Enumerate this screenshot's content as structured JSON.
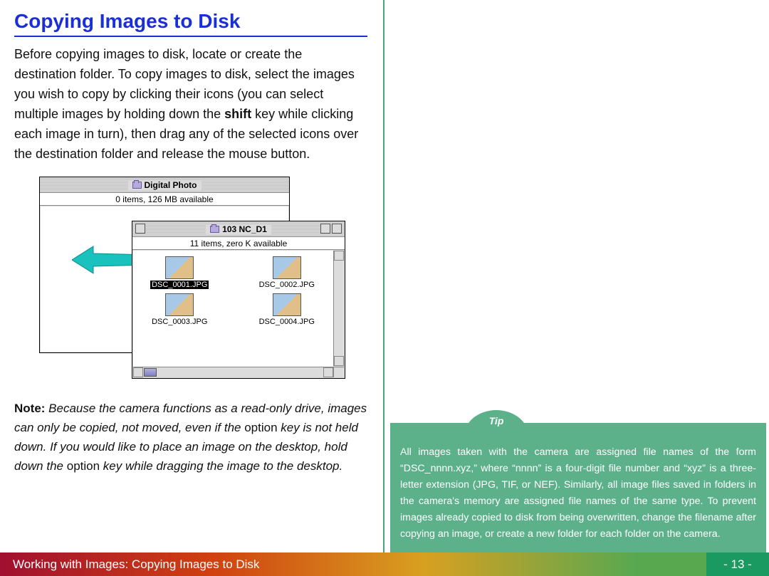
{
  "heading": "Copying Images to Disk",
  "body": {
    "p1a": "Before copying images to disk, locate or create the destination folder.  To copy images to disk, select the images you wish to copy by clicking their icons (you can select multiple images by holding down the ",
    "shift": "shift",
    "p1b": " key while clicking each image in turn), then drag any of the selected icons over the destination folder and release the mouse button."
  },
  "figure": {
    "back": {
      "title": "Digital Photo",
      "status": "0 items, 126 MB available"
    },
    "front": {
      "title": "103 NC_D1",
      "status": "11 items, zero K available",
      "files": [
        "DSC_0001.JPG",
        "DSC_0002.JPG",
        "DSC_0003.JPG",
        "DSC_0004.JPG"
      ]
    }
  },
  "note": {
    "label": "Note:",
    "a": " Because the camera functions as a read-only drive, images can only be copied, not moved, even if the ",
    "opt1": "option",
    "b": " key is not held down.  If you would like to place an image on the desktop, hold down the ",
    "opt2": "option",
    "c": " key while dragging the image to the desktop."
  },
  "tip": {
    "label": "Tip",
    "text": "All images taken with the camera are assigned file names of the form “DSC_nnnn.xyz,” where “nnnn” is a four-digit file number and “xyz” is a three-letter extension (JPG, TIF, or NEF).  Similarly, all image files saved in folders in the camera's memory are assigned file names of the same type. To prevent images already copied to disk from being overwritten, change the filename after copying an image, or create a new folder for each folder on the camera."
  },
  "footer": {
    "left": "Working with Images:  Copying Images to Disk",
    "right": "- 13 -"
  }
}
